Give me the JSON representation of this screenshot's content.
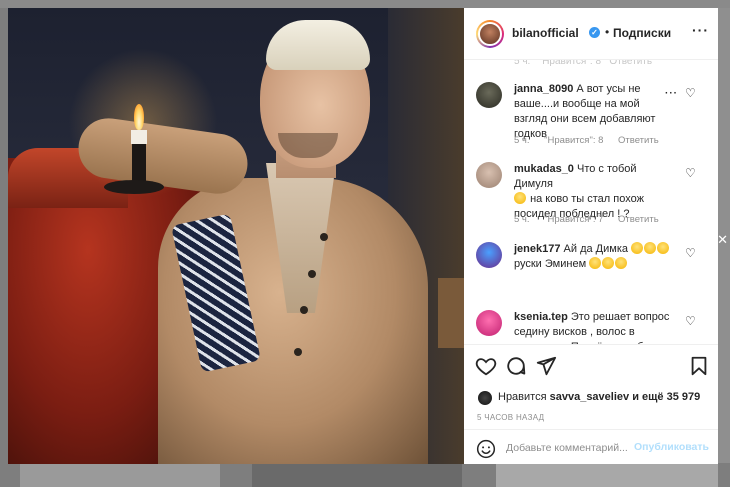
{
  "post": {
    "username": "bilanofficial",
    "dot": "•",
    "follow_label": "Подписки",
    "more_label": "···"
  },
  "comments": [
    {
      "username": "janna_8090",
      "text": "А вот усы не ваше....и вообще на мой взгляд они всем добавляют годков",
      "time": "5 ч.",
      "likes_label": "\"Нравится\": 8",
      "reply_label": "Ответить"
    },
    {
      "username": "mukadas_0",
      "text_before": "Что с тобой Димуля",
      "text_after": "на ково ты стал похож посидел побледнел ! ?",
      "time": "5 ч.",
      "likes_label": "\"Нравится\": 7",
      "reply_label": "Ответить"
    },
    {
      "username": "jenek177",
      "text_before": "Ай да Димка",
      "text_after": "руски Эминем"
    },
    {
      "username": "ksenia.tep",
      "text": "Это решает вопрос седину висков , волос в целом, да. Причём в любом месте. И"
    }
  ],
  "likes": {
    "prefix": "Нравится",
    "user": "savva_saveliev",
    "suffix": "и ещё 35 979"
  },
  "timestamp": "5 ЧАСОВ НАЗАД",
  "add_comment": {
    "placeholder": "Добавьте комментарий...",
    "publish_label": "Опубликовать"
  },
  "colors": {
    "verified": "#3897f0",
    "publish_disabled": "#b2dffc",
    "meta_gray": "#8e8e8e"
  },
  "icons": [
    "verified-badge-icon",
    "more-options-icon",
    "heart-icon",
    "comment-icon",
    "share-icon",
    "bookmark-icon",
    "smile-icon"
  ]
}
